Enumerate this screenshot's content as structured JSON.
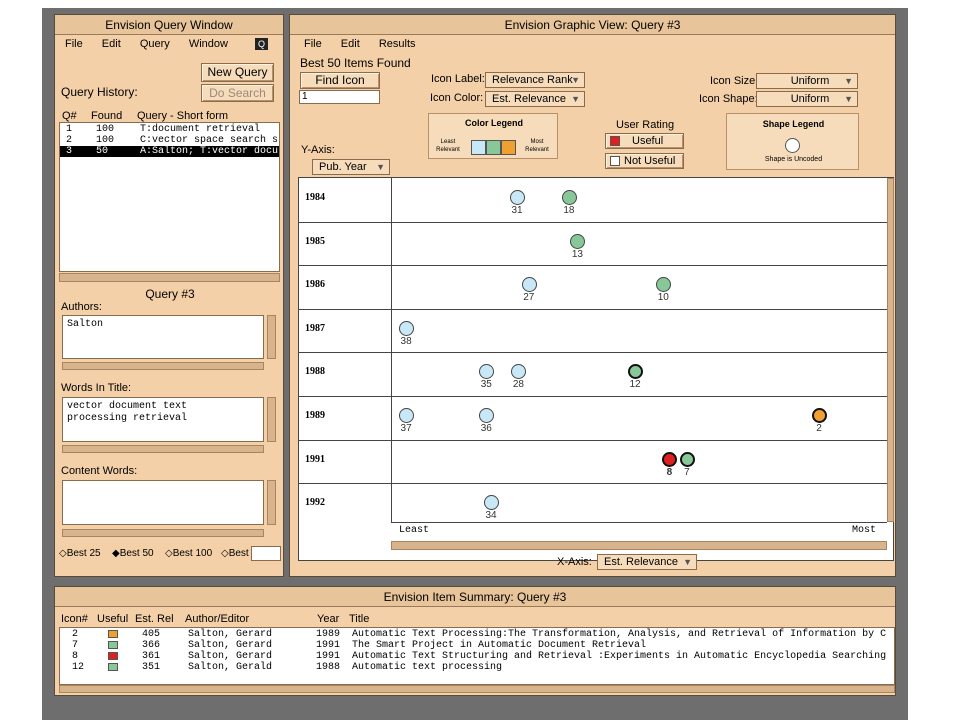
{
  "query_window": {
    "title": "Envision Query Window",
    "menu": [
      "File",
      "Edit",
      "Query",
      "Window"
    ],
    "menu_icon": "Q",
    "new_query": "New Query",
    "do_search": "Do Search",
    "history_label": "Query History:",
    "history_headers": [
      "Q#",
      "Found",
      "Query - Short form"
    ],
    "history": [
      {
        "q": "1",
        "found": "100",
        "text": "T:document retrieval"
      },
      {
        "q": "2",
        "found": "100",
        "text": "C:vector space search s"
      },
      {
        "q": "3",
        "found": "50",
        "text": "A:Salton; T:vector docu"
      }
    ],
    "query_title": "Query #3",
    "authors_label": "Authors:",
    "authors_value": "Salton",
    "words_label": "Words In Title:",
    "words_value_1": "vector document text",
    "words_value_2": "processing retrieval",
    "content_label": "Content Words:",
    "best": [
      "Best 25",
      "Best 50",
      "Best 100",
      "Best"
    ]
  },
  "graphic_view": {
    "title": "Envision Graphic View: Query #3",
    "menu": [
      "File",
      "Edit",
      "Results"
    ],
    "found_text": "Best 50 Items Found",
    "find_icon": "Find Icon",
    "find_value": "1",
    "icon_label_label": "Icon Label:",
    "icon_label_value": "Relevance Rank",
    "icon_color_label": "Icon Color:",
    "icon_color_value": "Est. Relevance",
    "icon_size_label": "Icon Size:",
    "icon_size_value": "Uniform",
    "icon_shape_label": "Icon Shape:",
    "icon_shape_value": "Uniform",
    "color_legend_title": "Color Legend",
    "color_legend_least": "Least Relevant",
    "color_legend_most": "Most Relevant",
    "color_legend_colors": [
      "#c8e8f8",
      "#88c898",
      "#f0a030"
    ],
    "user_rating_title": "User Rating",
    "useful": "Useful",
    "not_useful": "Not Useful",
    "shape_legend_title": "Shape Legend",
    "shape_legend_text": "Shape is Uncoded",
    "y_axis_label": "Y-Axis:",
    "y_axis_value": "Pub. Year",
    "x_axis_label": "X-Axis:",
    "x_axis_value": "Est. Relevance",
    "x_least": "Least",
    "x_most": "Most",
    "years": [
      "1984",
      "1985",
      "1986",
      "1987",
      "1988",
      "1989",
      "1991",
      "1992"
    ],
    "items": [
      {
        "year": "1984",
        "rel": 0.25,
        "rank": "31",
        "color": "#c8e8f8"
      },
      {
        "year": "1984",
        "rel": 0.36,
        "rank": "18",
        "color": "#88c898"
      },
      {
        "year": "1985",
        "rel": 0.378,
        "rank": "13",
        "color": "#88c898"
      },
      {
        "year": "1986",
        "rel": 0.275,
        "rank": "27",
        "color": "#c8e8f8"
      },
      {
        "year": "1986",
        "rel": 0.56,
        "rank": "10",
        "color": "#88c898"
      },
      {
        "year": "1987",
        "rel": 0.015,
        "rank": "38",
        "color": "#c8e8f8"
      },
      {
        "year": "1988",
        "rel": 0.185,
        "rank": "35",
        "color": "#c8e8f8"
      },
      {
        "year": "1988",
        "rel": 0.253,
        "rank": "28",
        "color": "#c8e8f8"
      },
      {
        "year": "1988",
        "rel": 0.5,
        "rank": "12",
        "color": "#88c898",
        "bold": true
      },
      {
        "year": "1989",
        "rel": 0.015,
        "rank": "37",
        "color": "#c8e8f8"
      },
      {
        "year": "1989",
        "rel": 0.185,
        "rank": "36",
        "color": "#c8e8f8"
      },
      {
        "year": "1989",
        "rel": 0.89,
        "rank": "2",
        "color": "#f0a030",
        "bold": true
      },
      {
        "year": "1991",
        "rel": 0.573,
        "rank": "8",
        "color": "#e02020",
        "bold": true
      },
      {
        "year": "1991",
        "rel": 0.61,
        "rank": "7",
        "color": "#88c898",
        "bold": true
      },
      {
        "year": "1992",
        "rel": 0.195,
        "rank": "34",
        "color": "#c8e8f8"
      }
    ]
  },
  "summary": {
    "title": "Envision Item Summary: Query #3",
    "headers": [
      "Icon#",
      "Useful",
      "Est. Rel",
      "Author/Editor",
      "Year",
      "Title"
    ],
    "rows": [
      {
        "icon": "2",
        "useful_color": "#f0a030",
        "rel": "405",
        "author": "Salton, Gerard",
        "year": "1989",
        "title": "Automatic Text Processing:The Transformation, Analysis, and Retrieval of Information by C"
      },
      {
        "icon": "7",
        "useful_color": "#88c898",
        "rel": "366",
        "author": "Salton, Gerard",
        "year": "1991",
        "title": "The Smart Project in Automatic Document Retrieval"
      },
      {
        "icon": "8",
        "useful_color": "#e02020",
        "rel": "361",
        "author": "Salton, Gerard",
        "year": "1991",
        "title": "Automatic Text Structuring and Retrieval :Experiments in Automatic Encyclopedia Searching"
      },
      {
        "icon": "12",
        "useful_color": "#88c898",
        "rel": "351",
        "author": "Salton, Gerald",
        "year": "1988",
        "title": "Automatic text processing"
      }
    ]
  }
}
